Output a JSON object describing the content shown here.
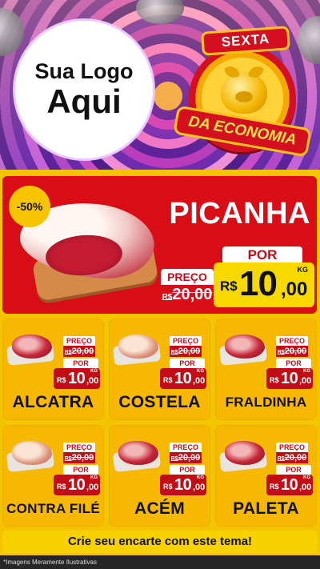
{
  "header": {
    "logo_line1": "Sua Logo",
    "logo_line2": "Aqui",
    "badge_top": "SEXTA",
    "badge_bottom": "DA ECONOMIA"
  },
  "hero": {
    "discount": "-50%",
    "product": "PICANHA",
    "preco_label": "PREÇO",
    "old_currency": "R$",
    "old_price": "20,00",
    "por_label": "POR",
    "currency": "R$",
    "price_int": "10",
    "price_dec": ",00",
    "unit": "KG"
  },
  "products": [
    {
      "name": "ALCATRA",
      "preco_label": "PREÇO",
      "old_currency": "R$",
      "old_price": "20,00",
      "por_label": "POR",
      "currency": "R$",
      "price_int": "10",
      "price_dec": ",00",
      "unit": "KG"
    },
    {
      "name": "COSTELA",
      "preco_label": "PREÇO",
      "old_currency": "R$",
      "old_price": "20,00",
      "por_label": "POR",
      "currency": "R$",
      "price_int": "10",
      "price_dec": ",00",
      "unit": "KG"
    },
    {
      "name": "FRALDINHA",
      "preco_label": "PREÇO",
      "old_currency": "R$",
      "old_price": "20,00",
      "por_label": "POR",
      "currency": "R$",
      "price_int": "10",
      "price_dec": ",00",
      "unit": "KG"
    },
    {
      "name": "CONTRA FILÉ",
      "preco_label": "PREÇO",
      "old_currency": "R$",
      "old_price": "20,00",
      "por_label": "POR",
      "currency": "R$",
      "price_int": "10",
      "price_dec": ",00",
      "unit": "KG"
    },
    {
      "name": "ACÉM",
      "preco_label": "PREÇO",
      "old_currency": "R$",
      "old_price": "20,00",
      "por_label": "POR",
      "currency": "R$",
      "price_int": "10",
      "price_dec": ",00",
      "unit": "KG"
    },
    {
      "name": "PALETA",
      "preco_label": "PREÇO",
      "old_currency": "R$",
      "old_price": "20,00",
      "por_label": "POR",
      "currency": "R$",
      "price_int": "10",
      "price_dec": ",00",
      "unit": "KG"
    }
  ],
  "cta": {
    "label": "Crie seu encarte com este tema!"
  },
  "footer": {
    "note": "*Imagens Meramente Ilustrativas"
  },
  "colors": {
    "red": "#d90d16",
    "yellow": "#f6b800",
    "purple": "#6a1fa0"
  }
}
